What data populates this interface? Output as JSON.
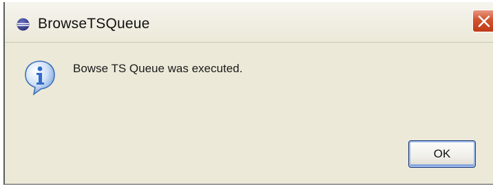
{
  "window": {
    "title": "BrowseTSQueue",
    "app_icon": "eclipse-icon",
    "close_icon": "close-icon"
  },
  "dialog": {
    "icon": "info-icon",
    "message": "Bowse TS Queue was executed.",
    "ok_label": "OK"
  },
  "colors": {
    "dialog_background": "#ece9d8",
    "close_button": "#d1522f",
    "info_icon_blue": "#2f6cc9"
  }
}
